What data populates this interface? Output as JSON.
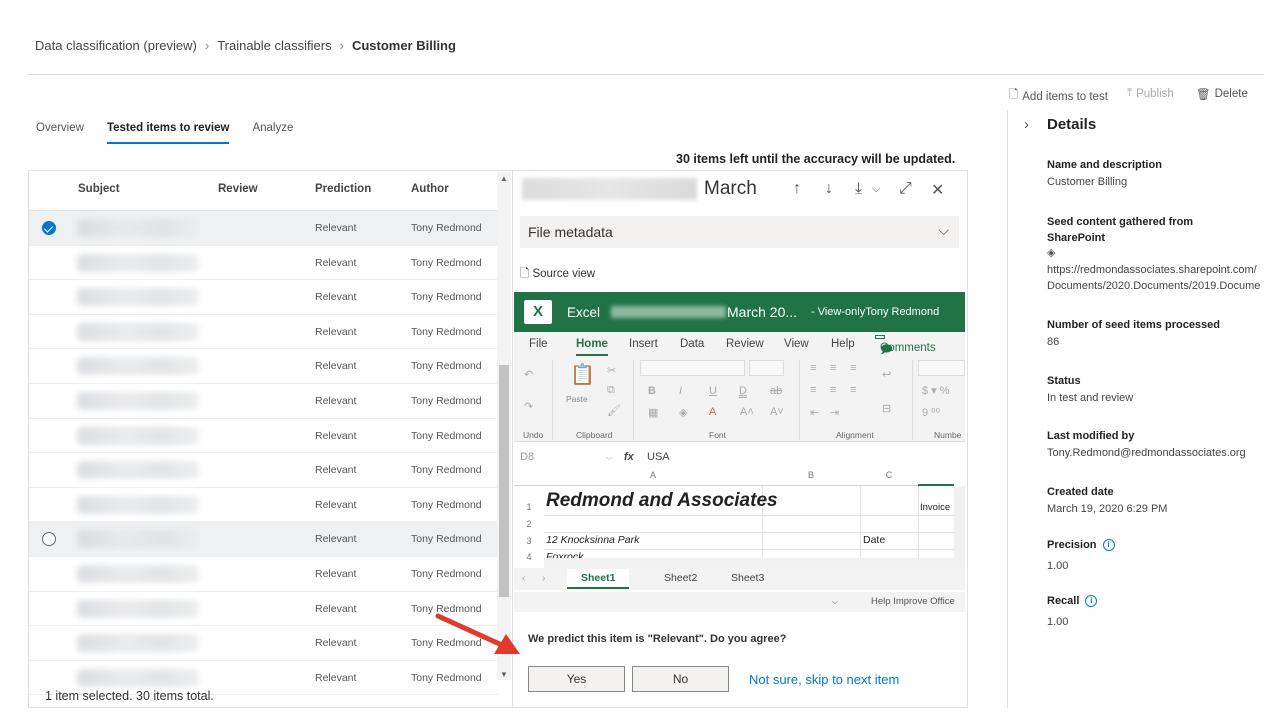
{
  "breadcrumb": [
    "Data classification (preview)",
    "Trainable classifiers",
    "Customer Billing"
  ],
  "tabs": [
    "Overview",
    "Tested items to review",
    "Analyze"
  ],
  "list": {
    "columns": [
      "Subject",
      "Review",
      "Prediction",
      "Author"
    ],
    "rows": [
      {
        "prediction": "Relevant",
        "author": "Tony Redmond"
      },
      {
        "prediction": "Relevant",
        "author": "Tony Redmond"
      },
      {
        "prediction": "Relevant",
        "author": "Tony Redmond"
      },
      {
        "prediction": "Relevant",
        "author": "Tony Redmond"
      },
      {
        "prediction": "Relevant",
        "author": "Tony Redmond"
      },
      {
        "prediction": "Relevant",
        "author": "Tony Redmond"
      },
      {
        "prediction": "Relevant",
        "author": "Tony Redmond"
      },
      {
        "prediction": "Relevant",
        "author": "Tony Redmond"
      },
      {
        "prediction": "Relevant",
        "author": "Tony Redmond"
      },
      {
        "prediction": "Relevant",
        "author": "Tony Redmond"
      },
      {
        "prediction": "Relevant",
        "author": "Tony Redmond"
      },
      {
        "prediction": "Relevant",
        "author": "Tony Redmond"
      },
      {
        "prediction": "Relevant",
        "author": "Tony Redmond"
      },
      {
        "prediction": "Relevant",
        "author": "Tony Redmond"
      }
    ],
    "status": "1 item selected.  30 items total."
  },
  "preview": {
    "accuracy_note": "30 items left until the accuracy will be updated.",
    "title": "March",
    "metadata_label": "File metadata",
    "source_view": "Source view",
    "excel": {
      "app": "Excel",
      "doc": "March 20...",
      "mode": "-  View-onlyTony Redmond",
      "menu": [
        "File",
        "Home",
        "Insert",
        "Data",
        "Review",
        "View",
        "Help"
      ],
      "comments": "Comments",
      "groups": [
        "Undo",
        "Clipboard",
        "Font",
        "Alignment",
        "Numbe"
      ],
      "paste": "Paste",
      "name_box": "D8",
      "fx": "fx",
      "formula": "USA",
      "cols": [
        "A",
        "B",
        "C"
      ],
      "rows": [
        "1",
        "2",
        "3",
        "4"
      ],
      "cells": {
        "a1": "Redmond and Associates",
        "d1": "Invoice",
        "a3": "12 Knocksinna Park",
        "c3": "Date",
        "a4": "Foxrock"
      },
      "sheets": [
        "Sheet1",
        "Sheet2",
        "Sheet3"
      ],
      "help": "Help Improve Office"
    },
    "question": "We predict this item is \"Relevant\". Do you agree?",
    "yes": "Yes",
    "no": "No",
    "skip": "Not sure, skip to next item"
  },
  "actions": {
    "add": "Add items to test",
    "publish": "Publish",
    "delete": "Delete"
  },
  "details": {
    "title": "Details",
    "name_label": "Name and description",
    "name_value": "Customer Billing",
    "seed_label": "Seed content gathered from SharePoint",
    "seed_url1": "https://redmondassociates.sharepoint.com/",
    "seed_url2": "Documents/2020.Documents/2019.Docume",
    "count_label": "Number of seed items processed",
    "count_value": "86",
    "status_label": "Status",
    "status_value": "In test and review",
    "modified_label": "Last modified by",
    "modified_value": "Tony.Redmond@redmondassociates.org",
    "created_label": "Created date",
    "created_value": "March 19, 2020 6:29 PM",
    "precision_label": "Precision",
    "precision_value": "1.00",
    "recall_label": "Recall",
    "recall_value": "1.00"
  }
}
